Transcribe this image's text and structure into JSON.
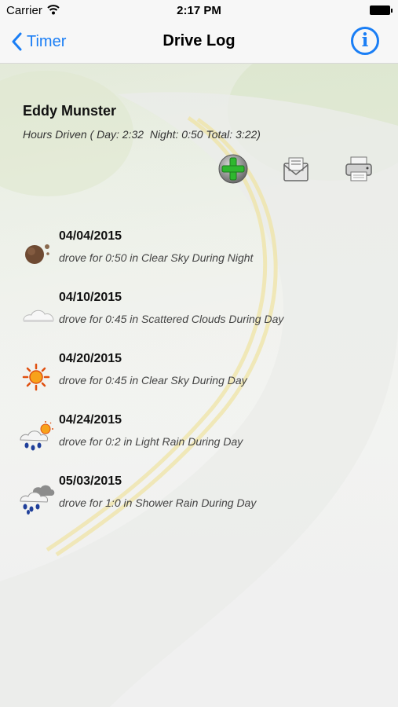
{
  "status_bar": {
    "carrier": "Carrier",
    "time": "2:17 PM"
  },
  "nav": {
    "back_label": "Timer",
    "title": "Drive Log",
    "info_label": "i"
  },
  "driver": {
    "name": "Eddy Munster",
    "hours_summary": "Hours Driven ( Day: 2:32  Night: 0:50 Total: 3:22)"
  },
  "actions": [
    {
      "name": "add",
      "icon": "plus-icon"
    },
    {
      "name": "email",
      "icon": "envelope-icon"
    },
    {
      "name": "print",
      "icon": "printer-icon"
    }
  ],
  "logs": [
    {
      "date": "04/04/2015",
      "description": "drove for 0:50 in Clear Sky During Night",
      "icon": "moon-icon"
    },
    {
      "date": "04/10/2015",
      "description": "drove for 0:45 in Scattered Clouds During Day",
      "icon": "cloud-icon"
    },
    {
      "date": "04/20/2015",
      "description": "drove for 0:45 in Clear Sky During Day",
      "icon": "sun-icon"
    },
    {
      "date": "04/24/2015",
      "description": "drove for 0:2 in Light Rain During Day",
      "icon": "rain-sun-icon"
    },
    {
      "date": "05/03/2015",
      "description": "drove for 1:0 in Shower Rain During Day",
      "icon": "shower-rain-icon"
    }
  ],
  "colors": {
    "accent": "#1a7ef5",
    "add_green": "#2fb82f"
  }
}
